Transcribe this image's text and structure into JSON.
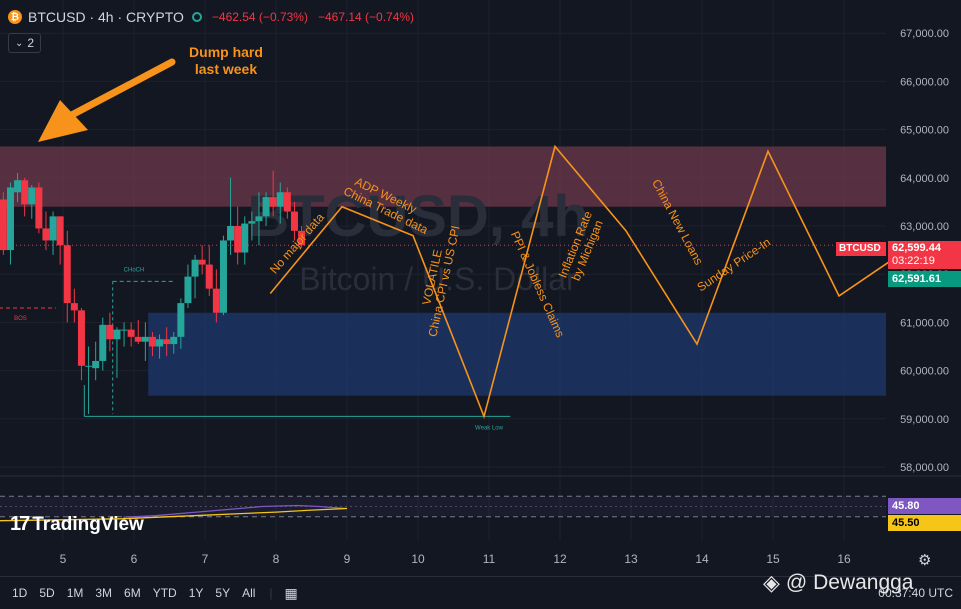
{
  "header": {
    "symbol": "BTCUSD",
    "sep1": "·",
    "interval": "4h",
    "sep2": "·",
    "exchange": "CRYPTO",
    "change1": "−462.54 (−0.73%)",
    "change2": "−467.14 (−0.74%)",
    "coin_glyph": "₿",
    "indicator_count": "2"
  },
  "colors": {
    "background": "#131722",
    "up": "#26a69a",
    "down": "#f23645",
    "annotation": "#f7931a",
    "resistance_zone": "#6e3a4c",
    "support_zone": "#1e3a6e",
    "rsi": "#7e57c2",
    "rsi_ma": "#f5c518"
  },
  "watermark": {
    "title": "BTCUSD, 4h",
    "subtitle": "Bitcoin / U.S. Dollar"
  },
  "price_labels": {
    "symbol_tag": "BTCUSD",
    "last_price": "62,599.44",
    "countdown": "03:22:19",
    "bid_price": "62,591.61"
  },
  "rsi_labels": {
    "rsi": "45.80",
    "rsi_ma": "45.50"
  },
  "chart_labels": {
    "bos": "BOS",
    "choch": "CHoCH",
    "weak_low": "Weak Low"
  },
  "annotations": {
    "dump": "Dump hard\nlast week",
    "no_major": "No major data",
    "adp": "ADP Weekly",
    "china_trade": "China Trade data",
    "volatile": "VOLATILE",
    "china_cpi": "China CPI vs US CPI",
    "ppi": "PPI & Jobless Claims",
    "inflation": "Inflation Rate",
    "michigan": "by Michigan",
    "china_loans": "China New Loans",
    "sunday": "Sunday Price-In"
  },
  "bottom_bar": {
    "timeframes": [
      "1D",
      "5D",
      "1M",
      "3M",
      "6M",
      "YTD",
      "1Y",
      "5Y",
      "All"
    ],
    "clock": "00:37:40 UTC"
  },
  "branding": {
    "tradingview": "TradingView",
    "watermark_user": "@ Dewangga"
  },
  "chart_data": [
    {
      "type": "candlestick",
      "title": "BTCUSD, 4h",
      "subtitle": "Bitcoin / U.S. Dollar",
      "x_ticks": [
        "5",
        "6",
        "7",
        "8",
        "9",
        "10",
        "11",
        "12",
        "13",
        "14",
        "15",
        "16"
      ],
      "y_ticks": [
        "58,000.00",
        "59,000.00",
        "60,000.00",
        "61,000.00",
        "62,000.00",
        "63,000.00",
        "64,000.00",
        "65,000.00",
        "66,000.00",
        "67,000.00"
      ],
      "ylim": [
        57500,
        67400
      ],
      "grid": true,
      "candles": [
        {
          "x": 4.06,
          "o": 64250,
          "h": 64700,
          "l": 63000,
          "c": 63500
        },
        {
          "x": 4.16,
          "o": 63550,
          "h": 63700,
          "l": 62400,
          "c": 62500
        },
        {
          "x": 4.26,
          "o": 62500,
          "h": 63900,
          "l": 62200,
          "c": 63800
        },
        {
          "x": 4.36,
          "o": 63700,
          "h": 64100,
          "l": 63500,
          "c": 63950
        },
        {
          "x": 4.46,
          "o": 63950,
          "h": 64000,
          "l": 63200,
          "c": 63450
        },
        {
          "x": 4.56,
          "o": 63450,
          "h": 63850,
          "l": 63150,
          "c": 63800
        },
        {
          "x": 4.66,
          "o": 63800,
          "h": 63900,
          "l": 62850,
          "c": 62950
        },
        {
          "x": 4.76,
          "o": 62950,
          "h": 63300,
          "l": 62500,
          "c": 62700
        },
        {
          "x": 4.86,
          "o": 62700,
          "h": 63300,
          "l": 62400,
          "c": 63200
        },
        {
          "x": 4.96,
          "o": 63200,
          "h": 63200,
          "l": 62200,
          "c": 62600
        },
        {
          "x": 5.06,
          "o": 62600,
          "h": 62900,
          "l": 61000,
          "c": 61400
        },
        {
          "x": 5.16,
          "o": 61400,
          "h": 61700,
          "l": 61000,
          "c": 61250
        },
        {
          "x": 5.26,
          "o": 61250,
          "h": 61300,
          "l": 59800,
          "c": 60100
        },
        {
          "x": 5.36,
          "o": 60100,
          "h": 60500,
          "l": 59100,
          "c": 60100
        },
        {
          "x": 5.46,
          "o": 60050,
          "h": 60600,
          "l": 59800,
          "c": 60200
        },
        {
          "x": 5.56,
          "o": 60200,
          "h": 61100,
          "l": 60000,
          "c": 60950
        },
        {
          "x": 5.66,
          "o": 60950,
          "h": 61200,
          "l": 60400,
          "c": 60650
        },
        {
          "x": 5.76,
          "o": 60650,
          "h": 60900,
          "l": 59850,
          "c": 60850
        },
        {
          "x": 5.86,
          "o": 60850,
          "h": 61000,
          "l": 60500,
          "c": 60850
        },
        {
          "x": 5.96,
          "o": 60850,
          "h": 61000,
          "l": 60500,
          "c": 60700
        },
        {
          "x": 6.06,
          "o": 60700,
          "h": 61050,
          "l": 60550,
          "c": 60600
        },
        {
          "x": 6.16,
          "o": 60600,
          "h": 61000,
          "l": 60200,
          "c": 60700
        },
        {
          "x": 6.26,
          "o": 60700,
          "h": 60800,
          "l": 60300,
          "c": 60500
        },
        {
          "x": 6.36,
          "o": 60500,
          "h": 60750,
          "l": 60250,
          "c": 60650
        },
        {
          "x": 6.46,
          "o": 60650,
          "h": 60900,
          "l": 60300,
          "c": 60550
        },
        {
          "x": 6.56,
          "o": 60550,
          "h": 60800,
          "l": 60350,
          "c": 60700
        },
        {
          "x": 6.66,
          "o": 60700,
          "h": 61500,
          "l": 60450,
          "c": 61400
        },
        {
          "x": 6.76,
          "o": 61400,
          "h": 62200,
          "l": 61300,
          "c": 61950
        },
        {
          "x": 6.86,
          "o": 61950,
          "h": 62400,
          "l": 61500,
          "c": 62300
        },
        {
          "x": 6.96,
          "o": 62300,
          "h": 62600,
          "l": 62000,
          "c": 62200
        },
        {
          "x": 7.06,
          "o": 62200,
          "h": 62600,
          "l": 61550,
          "c": 61700
        },
        {
          "x": 7.16,
          "o": 61700,
          "h": 62100,
          "l": 61000,
          "c": 61200
        },
        {
          "x": 7.26,
          "o": 61200,
          "h": 62800,
          "l": 61150,
          "c": 62700
        },
        {
          "x": 7.36,
          "o": 62700,
          "h": 64000,
          "l": 62400,
          "c": 63000
        },
        {
          "x": 7.46,
          "o": 63000,
          "h": 63400,
          "l": 62200,
          "c": 62450
        },
        {
          "x": 7.56,
          "o": 62450,
          "h": 63200,
          "l": 62200,
          "c": 63050
        },
        {
          "x": 7.66,
          "o": 63050,
          "h": 63300,
          "l": 62700,
          "c": 63100
        },
        {
          "x": 7.76,
          "o": 63100,
          "h": 63700,
          "l": 62600,
          "c": 63200
        },
        {
          "x": 7.86,
          "o": 63200,
          "h": 63700,
          "l": 63000,
          "c": 63600
        },
        {
          "x": 7.96,
          "o": 63600,
          "h": 64150,
          "l": 63200,
          "c": 63400
        },
        {
          "x": 8.06,
          "o": 63400,
          "h": 63900,
          "l": 63050,
          "c": 63700
        },
        {
          "x": 8.16,
          "o": 63700,
          "h": 63800,
          "l": 63150,
          "c": 63300
        },
        {
          "x": 8.26,
          "o": 63300,
          "h": 63500,
          "l": 62700,
          "c": 62900
        },
        {
          "x": 8.36,
          "o": 62900,
          "h": 63000,
          "l": 62550,
          "c": 62600
        }
      ],
      "zones": [
        {
          "name": "resistance",
          "x_start": 4.0,
          "x_end": 16.6,
          "y_low": 63400,
          "y_high": 64650
        },
        {
          "name": "support",
          "x_start": 6.2,
          "x_end": 16.6,
          "y_low": 59480,
          "y_high": 61200
        }
      ],
      "levels": [
        {
          "label": "BOS",
          "y": 61300,
          "x_start": 4.0,
          "x_end": 4.9,
          "style": "dashed"
        },
        {
          "label": "CHoCH",
          "y": 61850,
          "x_start": 5.7,
          "x_end": 6.55,
          "style": "dashed"
        },
        {
          "label": "Weak Low",
          "y": 59050,
          "x_start": 5.3,
          "x_end": 11.3,
          "style": "solid"
        },
        {
          "label": "last price",
          "y": 62599.44,
          "x_start": 4.0,
          "x_end": 16.6,
          "style": "dotted"
        }
      ],
      "projection_path": [
        [
          7.92,
          61600
        ],
        [
          8.93,
          63400
        ],
        [
          9.93,
          62800
        ],
        [
          10.93,
          59050
        ],
        [
          11.93,
          64650
        ],
        [
          12.93,
          62900
        ],
        [
          13.93,
          60550
        ],
        [
          14.93,
          64550
        ],
        [
          15.93,
          61550
        ],
        [
          16.93,
          62550
        ]
      ]
    },
    {
      "type": "line",
      "title": "RSI",
      "ylim": [
        0,
        100
      ],
      "series": [
        {
          "name": "RSI",
          "x": [
            5.85,
            6.3,
            6.8,
            7.3,
            7.8,
            8.3,
            8.6,
            9.0
          ],
          "values": [
            29,
            32,
            38,
            44,
            50,
            52,
            50,
            46
          ]
        },
        {
          "name": "RSI MA",
          "x": [
            4.0,
            5.0,
            5.85,
            6.5,
            7.0,
            7.5,
            8.0,
            8.5,
            9.0
          ],
          "values": [
            22,
            24,
            26,
            30,
            33,
            36,
            39,
            43,
            46
          ]
        }
      ],
      "bands": [
        70,
        30
      ]
    }
  ]
}
